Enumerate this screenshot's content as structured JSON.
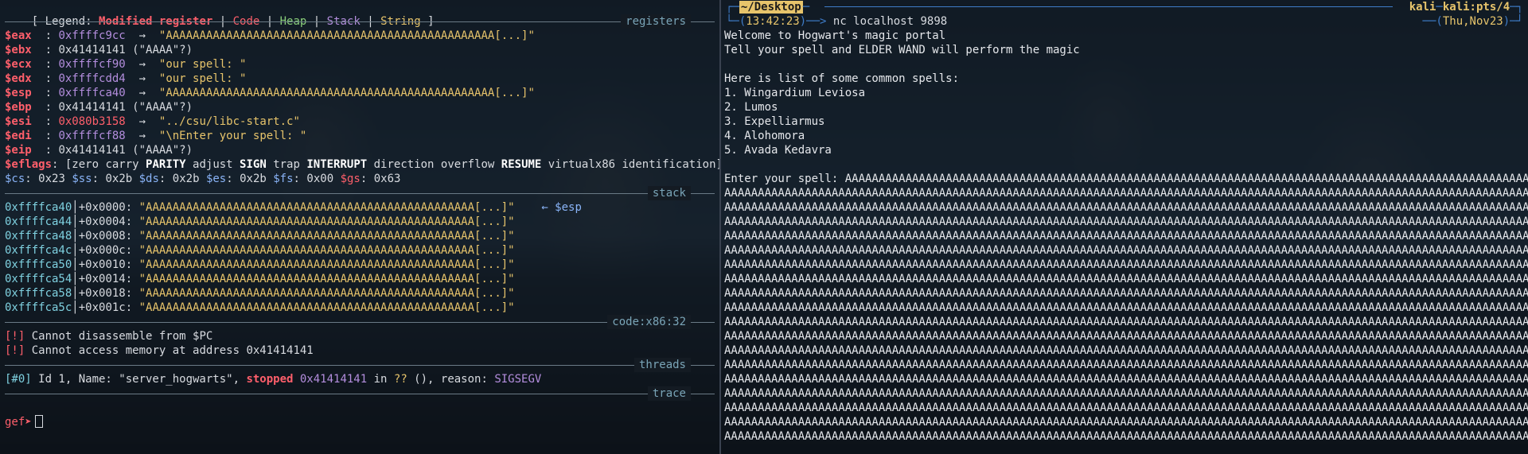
{
  "left": {
    "legend": {
      "open": "[ Legend: ",
      "modified": "Modified register",
      "code": "Code",
      "heap": "Heap",
      "stack": "Stack",
      "string": "String",
      "close": " ]",
      "sep": " | "
    },
    "sections": {
      "registers": "registers",
      "stack": "stack",
      "code": "code:x86:32",
      "threads": "threads",
      "trace": "trace"
    },
    "registers": [
      {
        "name": "$eax",
        "value": "0xffffc9cc",
        "value_color": "violet",
        "arrow": true,
        "deref": "\"AAAAAAAAAAAAAAAAAAAAAAAAAAAAAAAAAAAAAAAAAAAAAAAAA[...]\"",
        "deref_color": "yellow"
      },
      {
        "name": "$ebx",
        "value": "0x41414141",
        "value_color": "plain",
        "arrow": false,
        "deref": " (\"AAAA\"?)",
        "deref_color": "plain"
      },
      {
        "name": "$ecx",
        "value": "0xffffcf90",
        "value_color": "violet",
        "arrow": true,
        "deref": "\"our spell: \"",
        "deref_color": "yellow"
      },
      {
        "name": "$edx",
        "value": "0xffffcdd4",
        "value_color": "violet",
        "arrow": true,
        "deref": "\"our spell: \"",
        "deref_color": "yellow"
      },
      {
        "name": "$esp",
        "value": "0xffffca40",
        "value_color": "violet",
        "arrow": true,
        "deref": "\"AAAAAAAAAAAAAAAAAAAAAAAAAAAAAAAAAAAAAAAAAAAAAAAAA[...]\"",
        "deref_color": "yellow"
      },
      {
        "name": "$ebp",
        "value": "0x41414141",
        "value_color": "plain",
        "arrow": false,
        "deref": " (\"AAAA\"?)",
        "deref_color": "plain"
      },
      {
        "name": "$esi",
        "value": "0x080b3158",
        "value_color": "red",
        "arrow": true,
        "deref": "\"../csu/libc-start.c\"",
        "deref_color": "yellow"
      },
      {
        "name": "$edi",
        "value": "0xffffcf88",
        "value_color": "violet",
        "arrow": true,
        "deref": "\"\\nEnter your spell: \"",
        "deref_color": "yellow"
      },
      {
        "name": "$eip",
        "value": "0x41414141",
        "value_color": "plain",
        "arrow": false,
        "deref": " (\"AAAA\"?)",
        "deref_color": "plain"
      }
    ],
    "eflags_label": "$eflags",
    "eflags": [
      {
        "t": "[zero carry ",
        "bold": false
      },
      {
        "t": "PARITY",
        "bold": true
      },
      {
        "t": " adjust ",
        "bold": false
      },
      {
        "t": "SIGN",
        "bold": true
      },
      {
        "t": " trap ",
        "bold": false
      },
      {
        "t": "INTERRUPT",
        "bold": true
      },
      {
        "t": " direction overflow ",
        "bold": false
      },
      {
        "t": "RESUME",
        "bold": true
      },
      {
        "t": " virtualx86 identification]",
        "bold": false
      }
    ],
    "segments": [
      {
        "name": "$cs",
        "value": "0x23",
        "color": "blue"
      },
      {
        "name": "$ss",
        "value": "0x2b",
        "color": "blue"
      },
      {
        "name": "$ds",
        "value": "0x2b",
        "color": "blue"
      },
      {
        "name": "$es",
        "value": "0x2b",
        "color": "blue"
      },
      {
        "name": "$fs",
        "value": "0x00",
        "color": "blue"
      },
      {
        "name": "$gs",
        "value": "0x63",
        "color": "red"
      }
    ],
    "stack_rows": [
      {
        "addr": "0xffffca40",
        "off": "+0x0000",
        "val": "\"AAAAAAAAAAAAAAAAAAAAAAAAAAAAAAAAAAAAAAAAAAAAAAAAA[...]\"",
        "note": "← $esp"
      },
      {
        "addr": "0xffffca44",
        "off": "+0x0004",
        "val": "\"AAAAAAAAAAAAAAAAAAAAAAAAAAAAAAAAAAAAAAAAAAAAAAAAA[...]\"",
        "note": ""
      },
      {
        "addr": "0xffffca48",
        "off": "+0x0008",
        "val": "\"AAAAAAAAAAAAAAAAAAAAAAAAAAAAAAAAAAAAAAAAAAAAAAAAA[...]\"",
        "note": ""
      },
      {
        "addr": "0xffffca4c",
        "off": "+0x000c",
        "val": "\"AAAAAAAAAAAAAAAAAAAAAAAAAAAAAAAAAAAAAAAAAAAAAAAAA[...]\"",
        "note": ""
      },
      {
        "addr": "0xffffca50",
        "off": "+0x0010",
        "val": "\"AAAAAAAAAAAAAAAAAAAAAAAAAAAAAAAAAAAAAAAAAAAAAAAAA[...]\"",
        "note": ""
      },
      {
        "addr": "0xffffca54",
        "off": "+0x0014",
        "val": "\"AAAAAAAAAAAAAAAAAAAAAAAAAAAAAAAAAAAAAAAAAAAAAAAAA[...]\"",
        "note": ""
      },
      {
        "addr": "0xffffca58",
        "off": "+0x0018",
        "val": "\"AAAAAAAAAAAAAAAAAAAAAAAAAAAAAAAAAAAAAAAAAAAAAAAAA[...]\"",
        "note": ""
      },
      {
        "addr": "0xffffca5c",
        "off": "+0x001c",
        "val": "\"AAAAAAAAAAAAAAAAAAAAAAAAAAAAAAAAAAAAAAAAAAAAAAAAA[...]\"",
        "note": ""
      }
    ],
    "code_errors": [
      {
        "tag": "[!]",
        "msg": " Cannot disassemble from $PC"
      },
      {
        "tag": "[!]",
        "msg": " Cannot access memory at address 0x41414141"
      }
    ],
    "thread": {
      "tag": "[#0]",
      "pre": " Id 1, Name: \"server_hogwarts\", ",
      "state": "stopped",
      "addr": " 0x41414141",
      "in": " in ",
      "func": "??",
      "post": " (), reason: ",
      "reason": "SIGSEGV"
    },
    "prompt": "gef➤"
  },
  "right": {
    "header": {
      "path": "~/Desktop",
      "time": "13:42:23",
      "command": "nc localhost 9898",
      "user": "kali",
      "host": "kali:pts/4",
      "date": "Thu,Nov23"
    },
    "output_lines": [
      "Welcome to Hogwart's magic portal",
      "Tell your spell and ELDER WAND will perform the magic",
      "",
      "Here is list of some common spells:",
      "1. Wingardium Leviosa",
      "2. Lumos",
      "3. Expelliarmus",
      "4. Alohomora",
      "5. Avada Kedavra",
      ""
    ],
    "spell_prompt": "Enter your spell: ",
    "spell_input_first": "AAAAAAAAAAAAAAAAAAAAAAAAAAAAAAAAAAAAAAAAAAAAAAAAAAAAAAAAAAAAAAAAAAAAAAAAAAAAAAAAAAAAAAAAAAAAAAAAAAAAAAAA",
    "spell_input_line": "AAAAAAAAAAAAAAAAAAAAAAAAAAAAAAAAAAAAAAAAAAAAAAAAAAAAAAAAAAAAAAAAAAAAAAAAAAAAAAAAAAAAAAAAAAAAAAAAAAAAAAAAAAAAAAAAAAAAAAAAAAAAAAAAAAAAAAAAAA",
    "spell_input_repeat": 18
  }
}
